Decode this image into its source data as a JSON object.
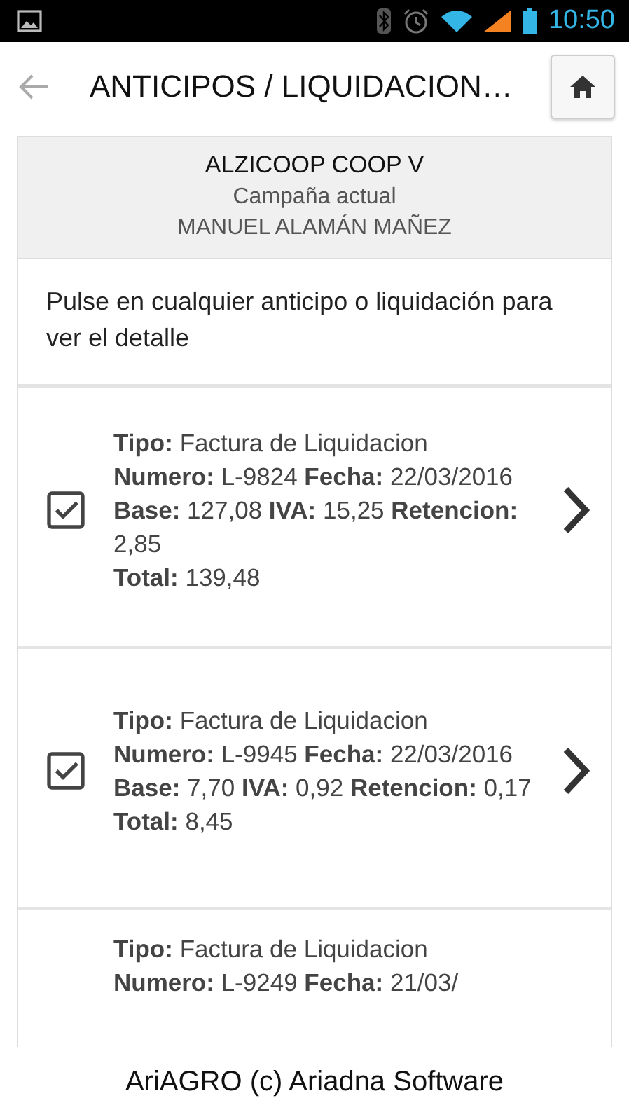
{
  "status_bar": {
    "time": "10:50"
  },
  "header": {
    "title": "ANTICIPOS / LIQUIDACION…"
  },
  "summary": {
    "company": "ALZICOOP COOP V",
    "campaign": "Campaña actual",
    "member": "MANUEL ALAMÁN MAÑEZ"
  },
  "instructions": "Pulse en cualquier anticipo o liquidación para ver el detalle",
  "items": [
    {
      "checked": true,
      "lines": [
        "**Tipo:** Factura de Liquidacion",
        "**Numero:** L-9824 **Fecha:** 22/03/2016",
        "**Base:** 127,08 **IVA:** 15,25 **Retencion:** 2,85",
        "**Total:** 139,48"
      ]
    },
    {
      "checked": true,
      "lines": [
        "**Tipo:** Factura de Liquidacion",
        "**Numero:** L-9945 **Fecha:** 22/03/2016",
        "**Base:** 7,70 **IVA:** 0,92 **Retencion:** 0,17",
        "**Total:** 8,45"
      ]
    },
    {
      "lines": [
        "**Tipo:** Factura de Liquidacion",
        "**Numero:** L-9249 **Fecha:** 21/03/"
      ]
    }
  ],
  "footer": "AriAGRO (c) Ariadna Software"
}
